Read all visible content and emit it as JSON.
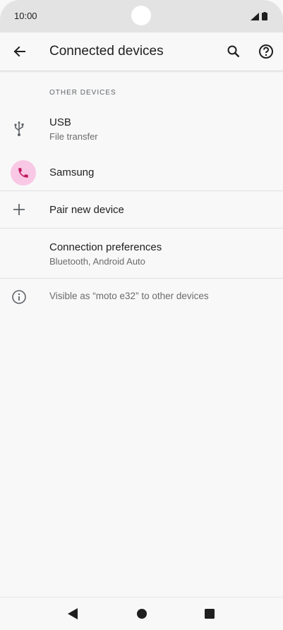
{
  "status_bar": {
    "time": "10:00"
  },
  "app_bar": {
    "title": "Connected devices",
    "back_icon": "arrow-back-icon",
    "search_icon": "search-icon",
    "help_icon": "help-icon"
  },
  "section": {
    "header": "OTHER DEVICES"
  },
  "items": [
    {
      "icon": "usb-icon",
      "title": "USB",
      "subtitle": "File transfer"
    },
    {
      "icon": "phone-icon",
      "title": "Samsung",
      "subtitle": ""
    },
    {
      "icon": "plus-icon",
      "title": "Pair new device",
      "subtitle": ""
    },
    {
      "icon": "",
      "title": "Connection preferences",
      "subtitle": "Bluetooth, Android Auto"
    }
  ],
  "footer": {
    "icon": "info-icon",
    "text": "Visible as “moto e32” to other devices"
  },
  "colors": {
    "accent_pink": "#f8c8e4",
    "phone_icon": "#c2185b"
  }
}
